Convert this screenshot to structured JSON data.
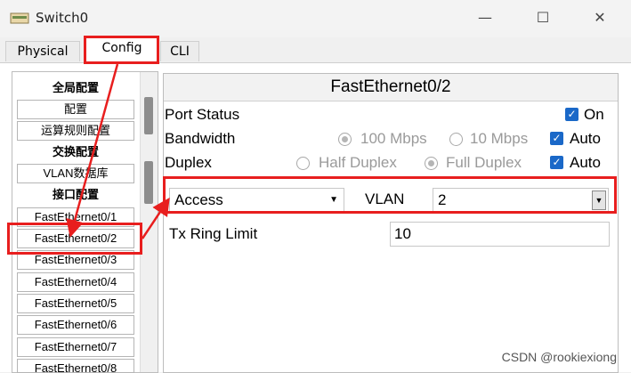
{
  "window": {
    "title": "Switch0"
  },
  "tabs": [
    {
      "label": "Physical"
    },
    {
      "label": "Config"
    },
    {
      "label": "CLI"
    }
  ],
  "sidebar": {
    "items": [
      {
        "label": "全局配置",
        "kind": "heading"
      },
      {
        "label": "配置",
        "kind": "item"
      },
      {
        "label": "运算规则配置",
        "kind": "item"
      },
      {
        "label": "交换配置",
        "kind": "heading"
      },
      {
        "label": "VLAN数据库",
        "kind": "item"
      },
      {
        "label": "接口配置",
        "kind": "heading"
      },
      {
        "label": "FastEthernet0/1",
        "kind": "item"
      },
      {
        "label": "FastEthernet0/2",
        "kind": "item",
        "selected": true
      },
      {
        "label": "FastEthernet0/3",
        "kind": "item"
      },
      {
        "label": "FastEthernet0/4",
        "kind": "item"
      },
      {
        "label": "FastEthernet0/5",
        "kind": "item"
      },
      {
        "label": "FastEthernet0/6",
        "kind": "item"
      },
      {
        "label": "FastEthernet0/7",
        "kind": "item"
      },
      {
        "label": "FastEthernet0/8",
        "kind": "item"
      }
    ]
  },
  "panel": {
    "header": "FastEthernet0/2",
    "port_status": {
      "label": "Port Status",
      "on_label": "On",
      "checked": true
    },
    "bandwidth": {
      "label": "Bandwidth",
      "opt1": "100 Mbps",
      "opt2": "10 Mbps",
      "auto_label": "Auto"
    },
    "duplex": {
      "label": "Duplex",
      "opt1": "Half Duplex",
      "opt2": "Full Duplex",
      "auto_label": "Auto"
    },
    "mode": {
      "value": "Access"
    },
    "vlan": {
      "label": "VLAN",
      "value": "2"
    },
    "tx_ring": {
      "label": "Tx Ring Limit",
      "value": "10"
    }
  },
  "watermark": "CSDN @rookiexiong",
  "colors": {
    "annotation": "#e81e1e",
    "checkbox": "#1a68c8"
  }
}
